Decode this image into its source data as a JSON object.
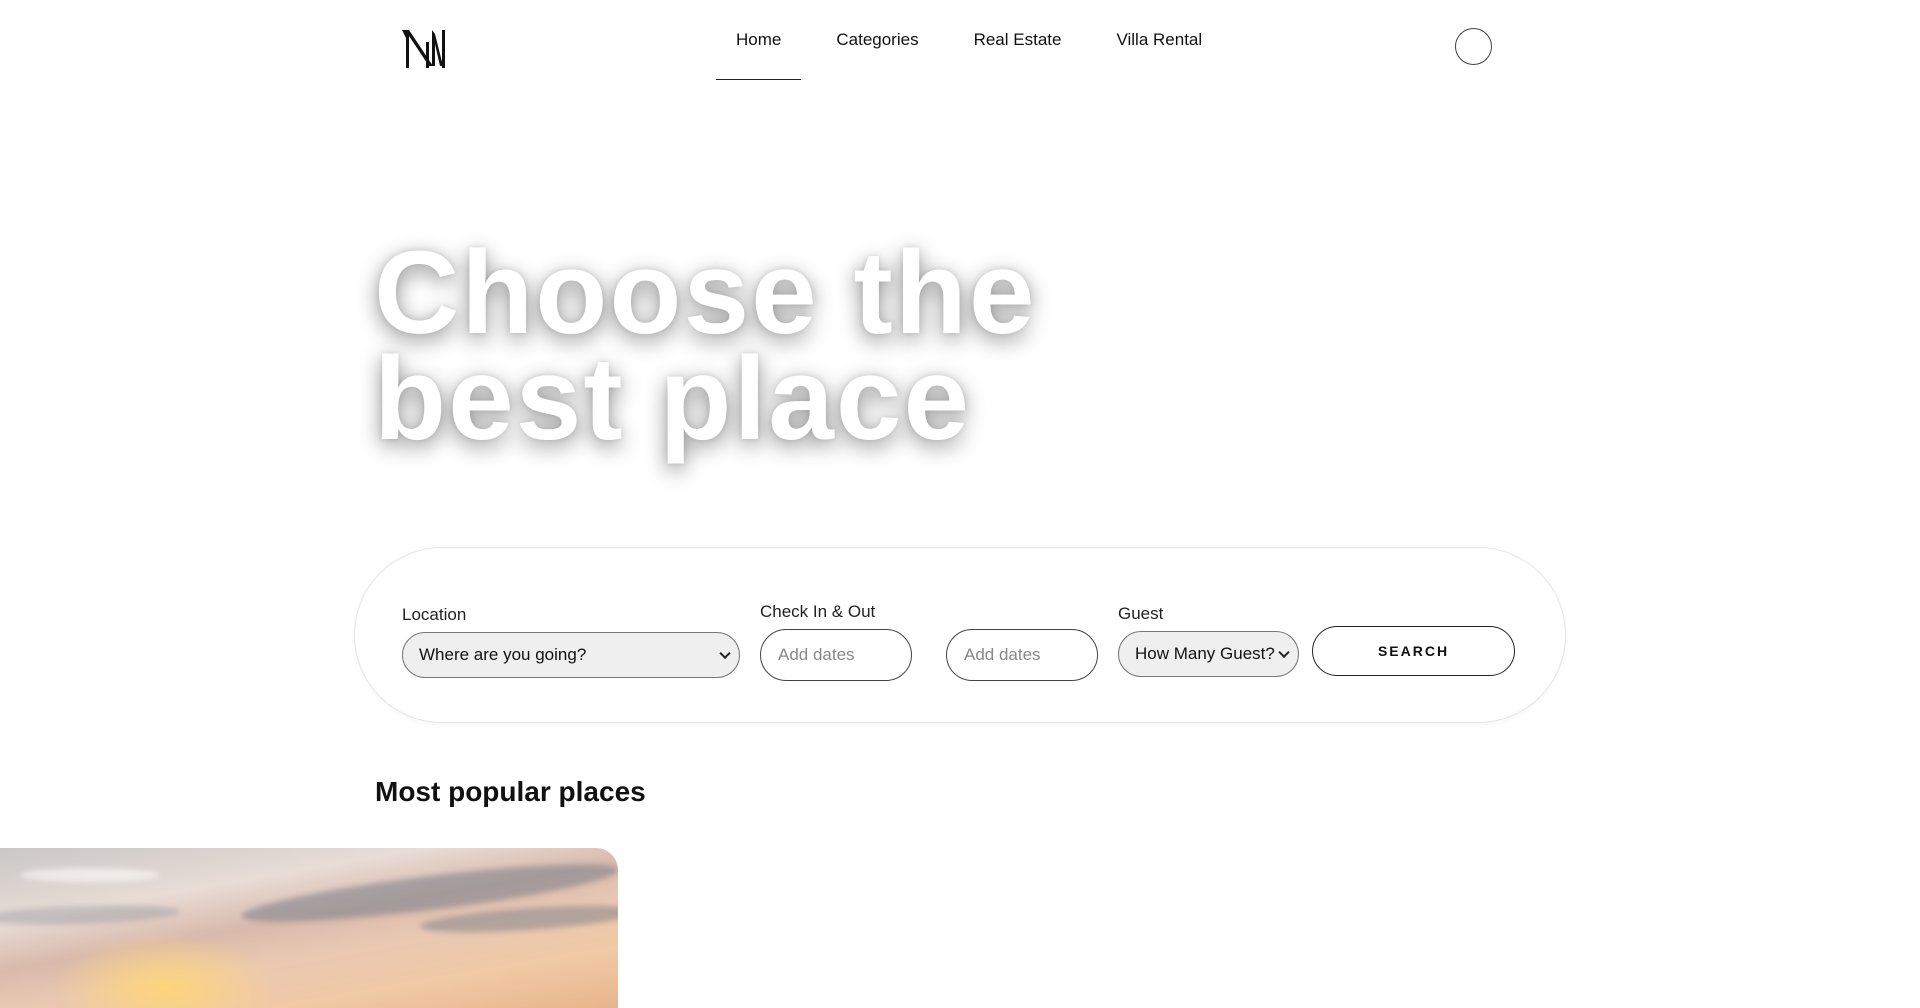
{
  "header": {
    "nav": [
      {
        "label": "Home",
        "active": true
      },
      {
        "label": "Categories",
        "active": false
      },
      {
        "label": "Real Estate",
        "active": false
      },
      {
        "label": "Villa Rental",
        "active": false
      }
    ]
  },
  "hero": {
    "title_line1": "Choose the",
    "title_line2": "best place"
  },
  "search": {
    "location_label": "Location",
    "location_value": "Where are you going?",
    "dates_label": "Check In & Out",
    "checkin_placeholder": "Add dates",
    "checkout_placeholder": "Add dates",
    "guest_label": "Guest",
    "guest_value": "How Many Guest?",
    "button_label": "SEARCH"
  },
  "popular": {
    "title": "Most popular places"
  },
  "colors": {
    "text": "#111111",
    "background": "#ffffff",
    "select_bg": "#efefef"
  }
}
